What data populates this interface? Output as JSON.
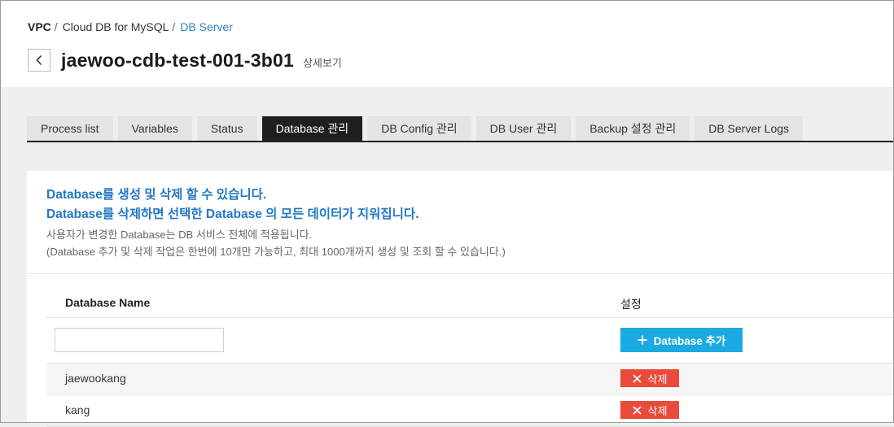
{
  "breadcrumb": {
    "root": "VPC",
    "service": "Cloud DB for MySQL",
    "current": "DB Server"
  },
  "header": {
    "title": "jaewoo-cdb-test-001-3b01",
    "subtitle": "상세보기",
    "back_icon": "chevron-left-icon"
  },
  "tabs": [
    {
      "label": "Process list",
      "active": false
    },
    {
      "label": "Variables",
      "active": false
    },
    {
      "label": "Status",
      "active": false
    },
    {
      "label": "Database 관리",
      "active": true
    },
    {
      "label": "DB Config 관리",
      "active": false
    },
    {
      "label": "DB User 관리",
      "active": false
    },
    {
      "label": "Backup 설정 관리",
      "active": false
    },
    {
      "label": "DB Server Logs",
      "active": false
    }
  ],
  "info": {
    "line1": "Database를 생성 및 삭제 할 수 있습니다.",
    "line2": "Database를 삭제하면 선택한 Database 의 모든 데이터가 지워집니다.",
    "note1": "사용자가 변경한 Database는 DB 서비스 전체에 적용됩니다.",
    "note2": "(Database 추가 및 삭제 작업은 한번에 10개만 가능하고, 최대 1000개까지 생성 및 조회 할 수 있습니다.)"
  },
  "table": {
    "col_name": "Database Name",
    "col_setting": "설정",
    "input_value": "",
    "input_placeholder": "",
    "add_label": "Database 추가",
    "delete_label": "삭제",
    "rows": [
      {
        "name": "jaewookang"
      },
      {
        "name": "kang"
      }
    ]
  },
  "colors": {
    "accent_blue": "#2278c4",
    "add_button": "#1ba9e1",
    "delete_button": "#ea4a3a",
    "active_tab": "#1f1f1f"
  }
}
